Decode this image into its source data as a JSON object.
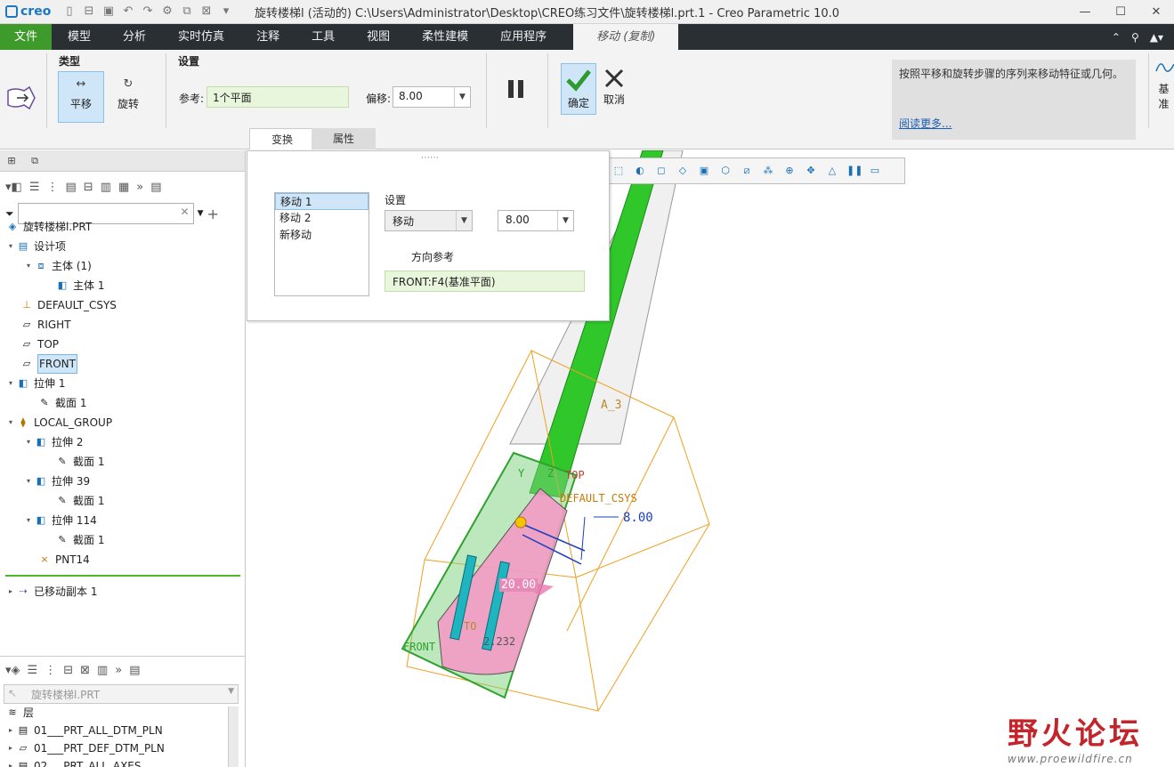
{
  "app": {
    "logo": "creo",
    "window_title": "旋转楼梯l (活动的) C:\\Users\\Administrator\\Desktop\\CREO练习文件\\旋转楼梯l.prt.1 - Creo Parametric 10.0",
    "window_buttons": [
      "—",
      "☐",
      "✕"
    ]
  },
  "tabs": {
    "file": "文件",
    "items": [
      "模型",
      "分析",
      "实时仿真",
      "注释",
      "工具",
      "视图",
      "柔性建模",
      "应用程序"
    ],
    "active": "移动 (复制)"
  },
  "ribbon": {
    "type_label": "类型",
    "translate_label": "平移",
    "rotate_label": "旋转",
    "settings_label": "设置",
    "ref_label": "参考:",
    "ref_value": "1个平面",
    "offset_label": "偏移:",
    "offset_value": "8.00",
    "ok_label": "确定",
    "cancel_label": "取消",
    "subtab_transform": "变换",
    "subtab_properties": "属性",
    "help_text": "按照平移和旋转步骤的序列来移动特征或几何。",
    "help_link": "阅读更多...",
    "datum_label": "基准"
  },
  "popup": {
    "moves": [
      "移动 1",
      "移动 2",
      "新移动"
    ],
    "settings_label": "设置",
    "mode_value": "移动",
    "amount_value": "8.00",
    "direction_label": "方向参考",
    "direction_value": "FRONT:F4(基准平面)"
  },
  "tree": {
    "root": "旋转楼梯l.PRT",
    "design_items": "设计项",
    "body_group": "主体 (1)",
    "body": "主体 1",
    "csys": "DEFAULT_CSYS",
    "right": "RIGHT",
    "top": "TOP",
    "front": "FRONT",
    "extrude1": "拉伸 1",
    "section": "截面 1",
    "local_group": "LOCAL_GROUP",
    "extrude2": "拉伸 2",
    "extrude39": "拉伸 39",
    "extrude114": "拉伸 114",
    "pnt": "PNT14",
    "moved_copy": "已移动副本 1"
  },
  "layers": {
    "part": "旋转楼梯l.PRT",
    "header": "层",
    "items": [
      "01___PRT_ALL_DTM_PLN",
      "01___PRT_DEF_DTM_PLN",
      "02___PRT_ALL_AXES"
    ]
  },
  "graphics": {
    "dim_offset": "8.00",
    "dim_angle": "20.00",
    "dim_other": "2.232",
    "label_a3": "A_3",
    "label_csys": "DEFAULT_CSYS",
    "label_top": "TOP",
    "label_top2": "TO",
    "label_front": "FRONT",
    "label_y": "Y",
    "label_z": "Z"
  },
  "watermark": {
    "text": "野火论坛",
    "url": "www.proewildfire.cn"
  }
}
